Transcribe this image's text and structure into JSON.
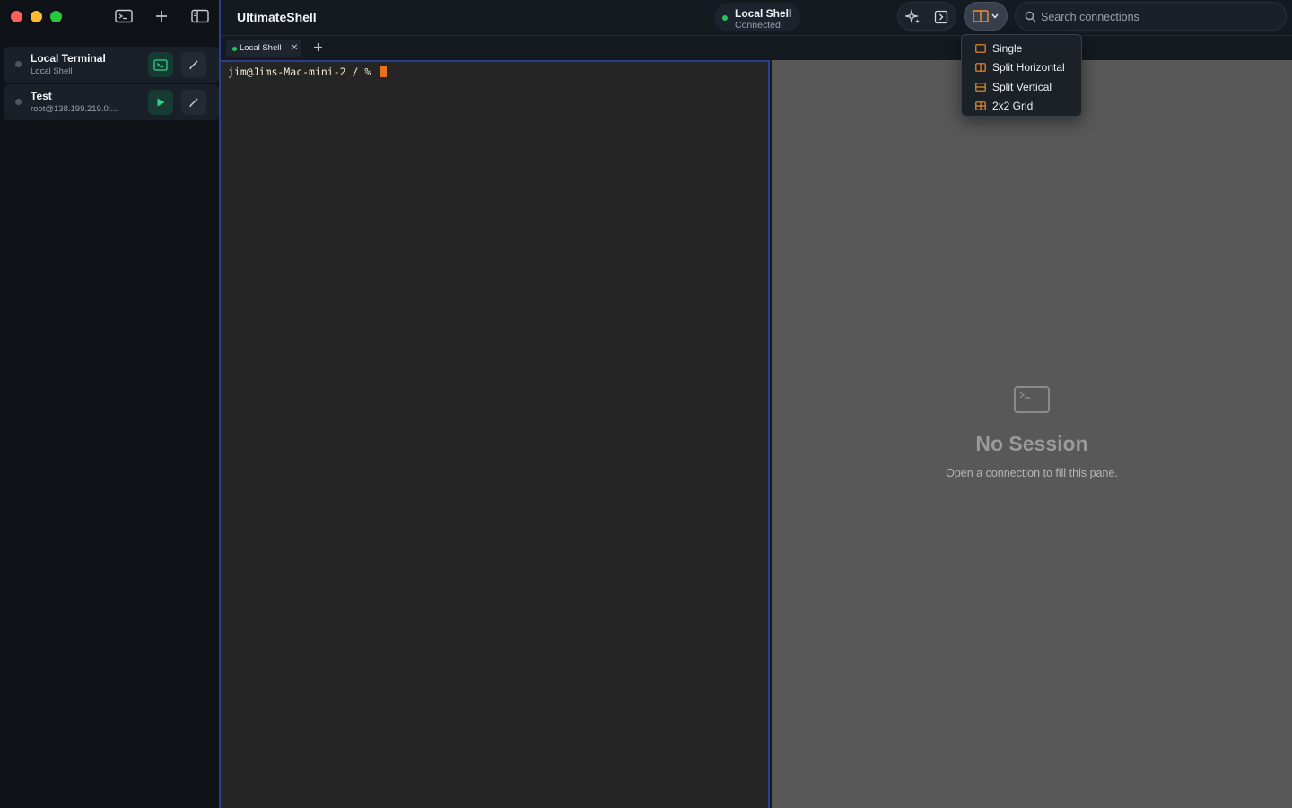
{
  "app": {
    "title": "UltimateShell"
  },
  "sidebar": {
    "toolbar": {
      "new_terminal_icon": "terminal-icon",
      "add_icon": "plus-icon",
      "toggle_sidebar_icon": "sidebar-icon"
    },
    "connections": [
      {
        "name": "Local Terminal",
        "subtitle": "Local Shell",
        "action": "open-terminal"
      },
      {
        "name": "Test",
        "subtitle": "root@138.199.219.0:...",
        "action": "connect"
      }
    ]
  },
  "status": {
    "title": "Local Shell",
    "state": "Connected",
    "color": "#22c55e"
  },
  "toolbar": {
    "ai_icon": "sparkle-icon",
    "snippets_icon": "code-panel-icon",
    "layout_icon": "split-layout-icon"
  },
  "search": {
    "placeholder": "Search connections",
    "value": ""
  },
  "tabs": [
    {
      "label": "Local Shell",
      "active": true
    }
  ],
  "terminal": {
    "prompt": "jim@Jims-Mac-mini-2 / % "
  },
  "empty_pane": {
    "title": "No Session",
    "subtitle": "Open a connection to fill this pane."
  },
  "layout_menu": {
    "items": [
      {
        "label": "Single",
        "icon": "single-pane-icon"
      },
      {
        "label": "Split Horizontal",
        "icon": "split-horizontal-icon"
      },
      {
        "label": "Split Vertical",
        "icon": "split-vertical-icon"
      },
      {
        "label": "2x2 Grid",
        "icon": "grid-icon"
      }
    ],
    "accent": "#f0902a"
  }
}
